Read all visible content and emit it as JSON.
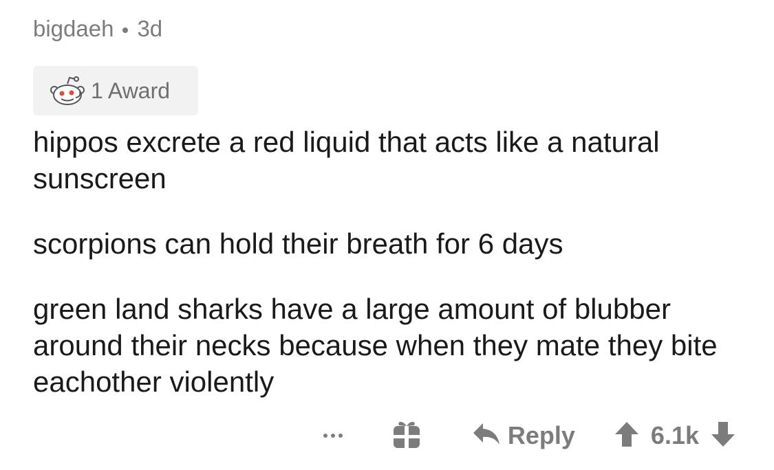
{
  "comment": {
    "username": "bigdaeh",
    "age": "3d",
    "award": {
      "icon": "snoo-award-icon",
      "label": "1 Award"
    },
    "paragraphs": [
      "hippos excrete a red liquid that acts like a natural sunscreen",
      "scorpions can hold their breath for 6 days",
      "green land sharks have a large amount of blubber around their necks because when they mate they bite eachother violently"
    ],
    "actions": {
      "more_icon": "more-options-icon",
      "gift_icon": "gift-icon",
      "reply_icon": "reply-arrow-icon",
      "reply_label": "Reply",
      "upvote_icon": "upvote-arrow-icon",
      "score": "6.1k",
      "downvote_icon": "downvote-arrow-icon"
    }
  },
  "colors": {
    "meta_text": "#7c7c7c",
    "body_text": "#1a1a1b",
    "award_bg": "#f2f2f2",
    "icon_gray": "#7c7c7c"
  }
}
